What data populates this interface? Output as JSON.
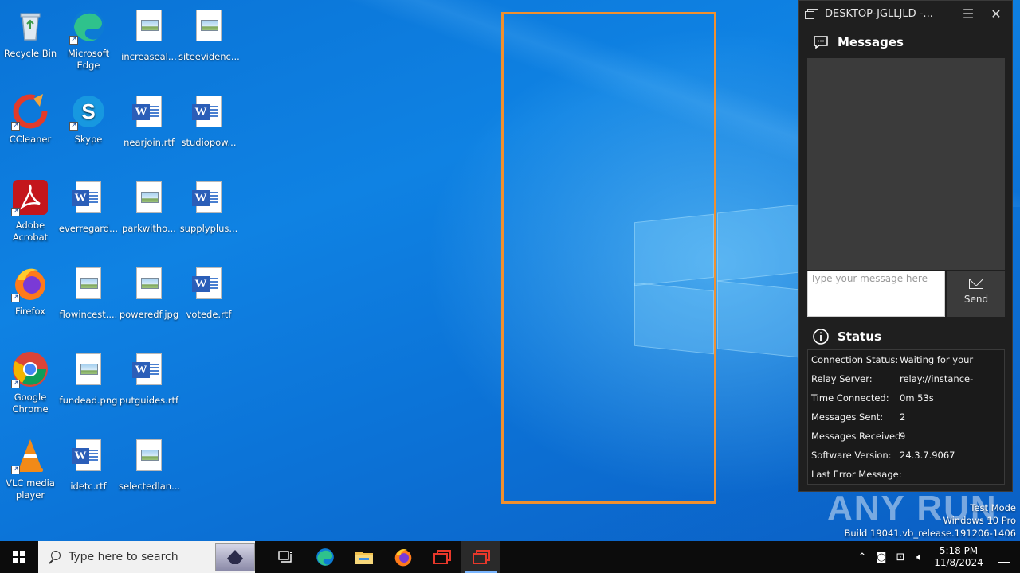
{
  "desktop_icons": [
    {
      "label": "Recycle Bin",
      "icon": "recycle-bin-icon"
    },
    {
      "label": "Microsoft Edge",
      "icon": "edge-icon"
    },
    {
      "label": "increaseal...",
      "icon": "image-file-icon"
    },
    {
      "label": "siteevidenc...",
      "icon": "image-file-icon"
    },
    {
      "label": "CCleaner",
      "icon": "ccleaner-icon"
    },
    {
      "label": "Skype",
      "icon": "skype-icon"
    },
    {
      "label": "nearjoin.rtf",
      "icon": "word-file-icon"
    },
    {
      "label": "studiopow...",
      "icon": "word-file-icon"
    },
    {
      "label": "Adobe Acrobat",
      "icon": "acrobat-icon"
    },
    {
      "label": "everregard...",
      "icon": "word-file-icon"
    },
    {
      "label": "parkwitho...",
      "icon": "image-file-icon"
    },
    {
      "label": "supplyplus...",
      "icon": "word-file-icon"
    },
    {
      "label": "Firefox",
      "icon": "firefox-icon"
    },
    {
      "label": "flowincest....",
      "icon": "image-file-icon"
    },
    {
      "label": "poweredf.jpg",
      "icon": "image-file-icon"
    },
    {
      "label": "votede.rtf",
      "icon": "word-file-icon"
    },
    {
      "label": "Google Chrome",
      "icon": "chrome-icon"
    },
    {
      "label": "fundead.png",
      "icon": "image-file-icon"
    },
    {
      "label": "putguides.rtf",
      "icon": "word-file-icon"
    },
    {
      "label": "VLC media player",
      "icon": "vlc-icon"
    },
    {
      "label": "idetc.rtf",
      "icon": "word-file-icon"
    },
    {
      "label": "selectedlan...",
      "icon": "image-file-icon"
    }
  ],
  "panel": {
    "title": "DESKTOP-JGLLJLD -...",
    "messages_heading": "Messages",
    "input_placeholder": "Type your message here",
    "send_label": "Send",
    "status_heading": "Status",
    "status_rows": [
      {
        "key": "Connection Status:",
        "value": "Waiting for your"
      },
      {
        "key": "Relay Server:",
        "value": "relay://instance-"
      },
      {
        "key": "Time Connected:",
        "value": "0m 53s"
      },
      {
        "key": "Messages Sent:",
        "value": "2"
      },
      {
        "key": "Messages Received:",
        "value": "9"
      },
      {
        "key": "Software Version:",
        "value": "24.3.7.9067"
      },
      {
        "key": "Last Error Message:",
        "value": ""
      }
    ]
  },
  "watermark": {
    "brand": "ANY RUN",
    "line1": "Test Mode",
    "line2": "Windows 10 Pro",
    "line3": "Build 19041.vb_release.191206-1406"
  },
  "taskbar": {
    "search_placeholder": "Type here to search",
    "time": "5:18 PM",
    "date": "11/8/2024"
  },
  "colors": {
    "selection_border": "#f0902f",
    "panel_bg": "#1f1f1f",
    "desktop_blue": "#0a78d7"
  }
}
